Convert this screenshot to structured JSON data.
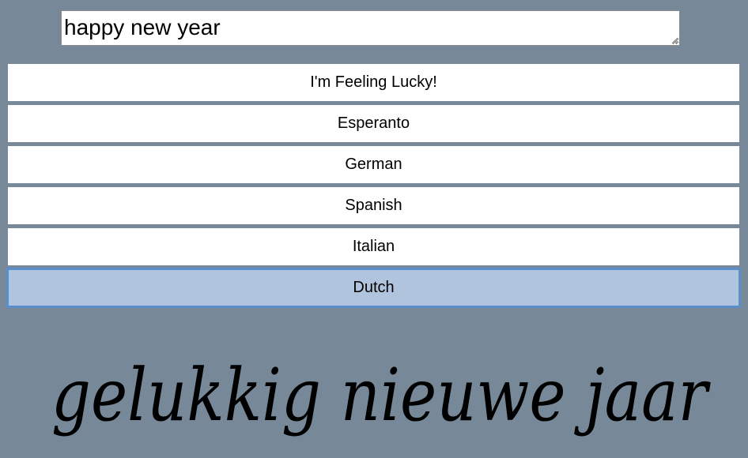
{
  "input": {
    "value": "happy new year"
  },
  "languages": [
    {
      "label": "I'm Feeling Lucky!",
      "selected": false
    },
    {
      "label": "Esperanto",
      "selected": false
    },
    {
      "label": "German",
      "selected": false
    },
    {
      "label": "Spanish",
      "selected": false
    },
    {
      "label": "Italian",
      "selected": false
    },
    {
      "label": "Dutch",
      "selected": true
    }
  ],
  "output": {
    "translation": "gelukkig nieuwe jaar"
  },
  "colors": {
    "page_background": "#778899",
    "selected_button": "#b0c4de",
    "selected_border": "#5b8fcc"
  }
}
